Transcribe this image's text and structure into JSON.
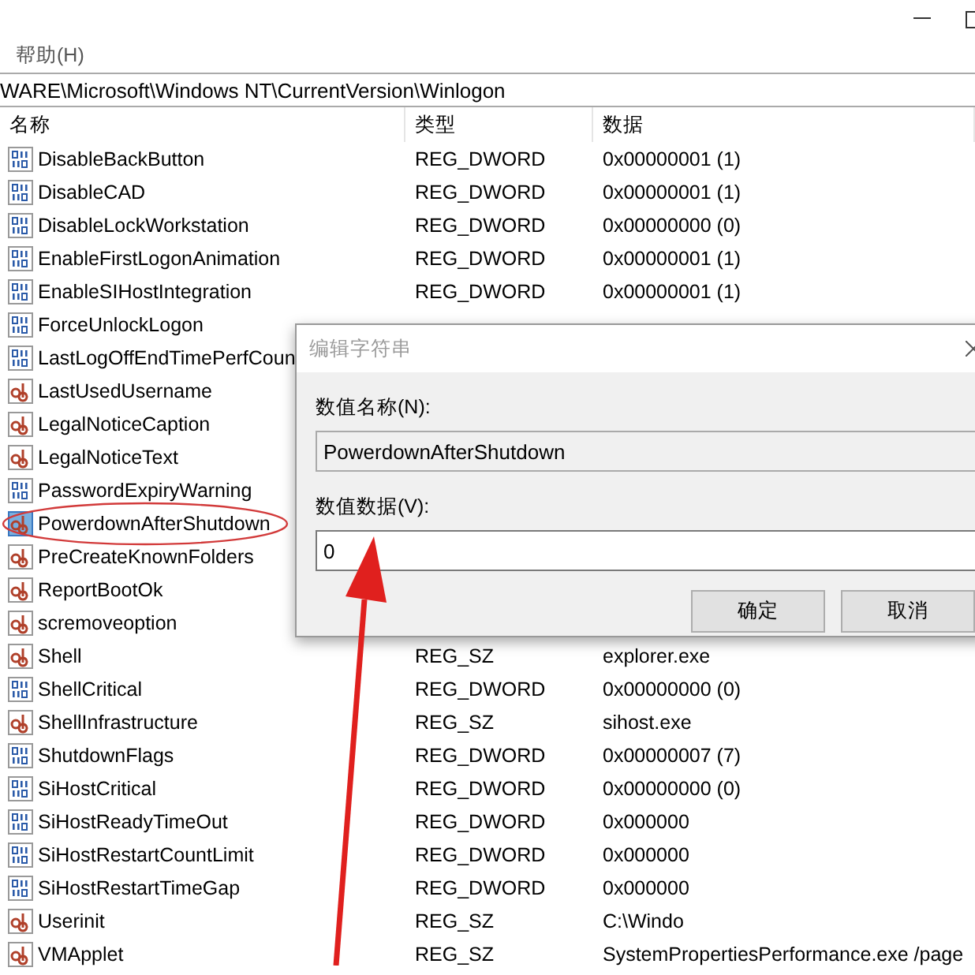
{
  "menu": [
    "帮助(H)"
  ],
  "address": "WARE\\Microsoft\\Windows NT\\CurrentVersion\\Winlogon",
  "columns": [
    "名称",
    "类型",
    "数据"
  ],
  "rows": [
    {
      "kind": "dword",
      "name": "DisableBackButton",
      "type": "REG_DWORD",
      "data": "0x00000001 (1)",
      "selected": false
    },
    {
      "kind": "dword",
      "name": "DisableCAD",
      "type": "REG_DWORD",
      "data": "0x00000001 (1)",
      "selected": false
    },
    {
      "kind": "dword",
      "name": "DisableLockWorkstation",
      "type": "REG_DWORD",
      "data": "0x00000000 (0)",
      "selected": false
    },
    {
      "kind": "dword",
      "name": "EnableFirstLogonAnimation",
      "type": "REG_DWORD",
      "data": "0x00000001 (1)",
      "selected": false
    },
    {
      "kind": "dword",
      "name": "EnableSIHostIntegration",
      "type": "REG_DWORD",
      "data": "0x00000001 (1)",
      "selected": false
    },
    {
      "kind": "dword",
      "name": "ForceUnlockLogon",
      "selected": false
    },
    {
      "kind": "dword",
      "name": "LastLogOffEndTimePerfCoun",
      "selected": false
    },
    {
      "kind": "sz",
      "name": "LastUsedUsername",
      "selected": false
    },
    {
      "kind": "sz",
      "name": "LegalNoticeCaption",
      "selected": false
    },
    {
      "kind": "sz",
      "name": "LegalNoticeText",
      "selected": false
    },
    {
      "kind": "dword",
      "name": "PasswordExpiryWarning",
      "selected": false
    },
    {
      "kind": "sz",
      "name": "PowerdownAfterShutdown",
      "selected": true
    },
    {
      "kind": "sz",
      "name": "PreCreateKnownFolders",
      "selected": false
    },
    {
      "kind": "sz",
      "name": "ReportBootOk",
      "selected": false
    },
    {
      "kind": "sz",
      "name": "scremoveoption",
      "selected": false
    },
    {
      "kind": "sz",
      "name": "Shell",
      "type": "REG_SZ",
      "data": "explorer.exe",
      "selected": false
    },
    {
      "kind": "dword",
      "name": "ShellCritical",
      "type": "REG_DWORD",
      "data": "0x00000000 (0)",
      "selected": false
    },
    {
      "kind": "sz",
      "name": "ShellInfrastructure",
      "type": "REG_SZ",
      "data": "sihost.exe",
      "selected": false
    },
    {
      "kind": "dword",
      "name": "ShutdownFlags",
      "type": "REG_DWORD",
      "data": "0x00000007 (7)",
      "selected": false
    },
    {
      "kind": "dword",
      "name": "SiHostCritical",
      "type": "REG_DWORD",
      "data": "0x00000000 (0)",
      "selected": false
    },
    {
      "kind": "dword",
      "name": "SiHostReadyTimeOut",
      "type": "REG_DWORD",
      "data": "0x000000",
      "selected": false
    },
    {
      "kind": "dword",
      "name": "SiHostRestartCountLimit",
      "type": "REG_DWORD",
      "data": "0x000000",
      "selected": false
    },
    {
      "kind": "dword",
      "name": "SiHostRestartTimeGap",
      "type": "REG_DWORD",
      "data": "0x000000",
      "selected": false
    },
    {
      "kind": "sz",
      "name": "Userinit",
      "type": "REG_SZ",
      "data": "C:\\Windo",
      "selected": false
    },
    {
      "kind": "sz",
      "name": "VMApplet",
      "type": "REG_SZ",
      "data": "SystemPropertiesPerformance.exe /page",
      "selected": false
    }
  ],
  "dialog": {
    "title": "编辑字符串",
    "name_label": "数值名称(N):",
    "name_value": "PowerdownAfterShutdown",
    "data_label": "数值数据(V):",
    "data_value": "0",
    "buttons": [
      "确定",
      "取消"
    ]
  }
}
